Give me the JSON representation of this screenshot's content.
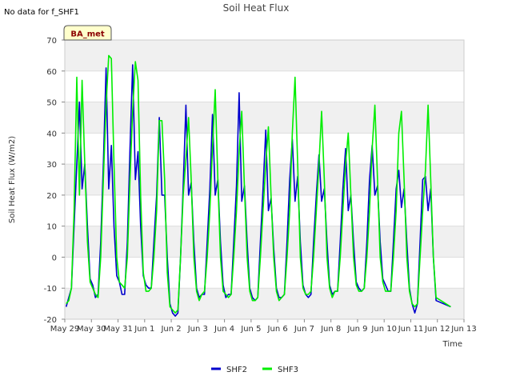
{
  "chart_data": {
    "type": "line",
    "title": "Soil Heat Flux",
    "note": "No data for f_SHF1",
    "badge": "BA_met",
    "xlabel": "Time",
    "ylabel": "Soil Heat Flux (W/m2)",
    "ylim": [
      -20,
      70
    ],
    "yticks": [
      -20,
      -10,
      0,
      10,
      20,
      30,
      40,
      50,
      60,
      70
    ],
    "xlim": [
      "2000-05-29",
      "2000-06-13"
    ],
    "xticks": [
      "May 29",
      "May 30",
      "May 31",
      "Jun 1",
      "Jun 2",
      "Jun 3",
      "Jun 4",
      "Jun 5",
      "Jun 6",
      "Jun 7",
      "Jun 8",
      "Jun 9",
      "Jun 10",
      "Jun 11",
      "Jun 12",
      "Jun 13"
    ],
    "grid": "horizontal bands",
    "legend": "bottom",
    "series": [
      {
        "name": "SHF2",
        "color": "#0000cc",
        "points": [
          [
            "May 29",
            -16
          ],
          [
            "May 29",
            -13
          ],
          [
            "May 29",
            -10
          ],
          [
            "May 29",
            10
          ],
          [
            "May 29",
            30
          ],
          [
            "May 29",
            50
          ],
          [
            "May 29",
            22
          ],
          [
            "May 29",
            30
          ],
          [
            "May 29",
            10
          ],
          [
            "May 29",
            -7
          ],
          [
            "May 30",
            -9
          ],
          [
            "May 30",
            -13
          ],
          [
            "May 30",
            -12
          ],
          [
            "May 30",
            5
          ],
          [
            "May 30",
            30
          ],
          [
            "May 30",
            61
          ],
          [
            "May 30",
            22
          ],
          [
            "May 30",
            36
          ],
          [
            "May 30",
            10
          ],
          [
            "May 30",
            -6
          ],
          [
            "May 31",
            -8
          ],
          [
            "May 31",
            -12
          ],
          [
            "May 31",
            -12
          ],
          [
            "May 31",
            5
          ],
          [
            "May 31",
            35
          ],
          [
            "May 31",
            62
          ],
          [
            "May 31",
            25
          ],
          [
            "May 31",
            34
          ],
          [
            "May 31",
            10
          ],
          [
            "May 31",
            -6
          ],
          [
            "Jun 1",
            -9
          ],
          [
            "Jun 1",
            -10
          ],
          [
            "Jun 1",
            -10
          ],
          [
            "Jun 1",
            5
          ],
          [
            "Jun 1",
            20
          ],
          [
            "Jun 1",
            45
          ],
          [
            "Jun 1",
            20
          ],
          [
            "Jun 1",
            20
          ],
          [
            "Jun 1",
            0
          ],
          [
            "Jun 1",
            -15
          ],
          [
            "Jun 2",
            -18
          ],
          [
            "Jun 2",
            -19
          ],
          [
            "Jun 2",
            -18
          ],
          [
            "Jun 2",
            0
          ],
          [
            "Jun 2",
            23
          ],
          [
            "Jun 2",
            49
          ],
          [
            "Jun 2",
            20
          ],
          [
            "Jun 2",
            24
          ],
          [
            "Jun 2",
            5
          ],
          [
            "Jun 2",
            -10
          ],
          [
            "Jun 3",
            -13
          ],
          [
            "Jun 3",
            -12
          ],
          [
            "Jun 3",
            -12
          ],
          [
            "Jun 3",
            5
          ],
          [
            "Jun 3",
            22
          ],
          [
            "Jun 3",
            46
          ],
          [
            "Jun 3",
            20
          ],
          [
            "Jun 3",
            25
          ],
          [
            "Jun 3",
            5
          ],
          [
            "Jun 3",
            -9
          ],
          [
            "Jun 4",
            -13
          ],
          [
            "Jun 4",
            -12
          ],
          [
            "Jun 4",
            -12
          ],
          [
            "Jun 4",
            5
          ],
          [
            "Jun 4",
            23
          ],
          [
            "Jun 4",
            53
          ],
          [
            "Jun 4",
            18
          ],
          [
            "Jun 4",
            23
          ],
          [
            "Jun 4",
            5
          ],
          [
            "Jun 4",
            -10
          ],
          [
            "Jun 5",
            -13
          ],
          [
            "Jun 5",
            -14
          ],
          [
            "Jun 5",
            -13
          ],
          [
            "Jun 5",
            5
          ],
          [
            "Jun 5",
            22
          ],
          [
            "Jun 5",
            41
          ],
          [
            "Jun 5",
            15
          ],
          [
            "Jun 5",
            19
          ],
          [
            "Jun 5",
            3
          ],
          [
            "Jun 5",
            -10
          ],
          [
            "Jun 6",
            -13
          ],
          [
            "Jun 6",
            -13
          ],
          [
            "Jun 6",
            -12
          ],
          [
            "Jun 6",
            5
          ],
          [
            "Jun 6",
            25
          ],
          [
            "Jun 6",
            38
          ],
          [
            "Jun 6",
            18
          ],
          [
            "Jun 6",
            26
          ],
          [
            "Jun 6",
            5
          ],
          [
            "Jun 6",
            -9
          ],
          [
            "Jun 7",
            -12
          ],
          [
            "Jun 7",
            -13
          ],
          [
            "Jun 7",
            -12
          ],
          [
            "Jun 7",
            5
          ],
          [
            "Jun 7",
            20
          ],
          [
            "Jun 7",
            33
          ],
          [
            "Jun 7",
            18
          ],
          [
            "Jun 7",
            22
          ],
          [
            "Jun 7",
            5
          ],
          [
            "Jun 7",
            -9
          ],
          [
            "Jun 8",
            -12
          ],
          [
            "Jun 8",
            -11
          ],
          [
            "Jun 8",
            -11
          ],
          [
            "Jun 8",
            5
          ],
          [
            "Jun 8",
            22
          ],
          [
            "Jun 8",
            35
          ],
          [
            "Jun 8",
            15
          ],
          [
            "Jun 8",
            20
          ],
          [
            "Jun 8",
            5
          ],
          [
            "Jun 8",
            -8
          ],
          [
            "Jun 9",
            -10
          ],
          [
            "Jun 9",
            -11
          ],
          [
            "Jun 9",
            -10
          ],
          [
            "Jun 9",
            5
          ],
          [
            "Jun 9",
            25
          ],
          [
            "Jun 9",
            36
          ],
          [
            "Jun 9",
            20
          ],
          [
            "Jun 9",
            23
          ],
          [
            "Jun 9",
            5
          ],
          [
            "Jun 9",
            -7
          ],
          [
            "Jun 10",
            -9
          ],
          [
            "Jun 10",
            -11
          ],
          [
            "Jun 10",
            -11
          ],
          [
            "Jun 10",
            5
          ],
          [
            "Jun 10",
            22
          ],
          [
            "Jun 10",
            28
          ],
          [
            "Jun 10",
            16
          ],
          [
            "Jun 10",
            22
          ],
          [
            "Jun 10",
            5
          ],
          [
            "Jun 10",
            -10
          ],
          [
            "Jun 11",
            -15
          ],
          [
            "Jun 11",
            -18
          ],
          [
            "Jun 11",
            -15
          ],
          [
            "Jun 11",
            5
          ],
          [
            "Jun 11",
            25
          ],
          [
            "Jun 11",
            26
          ],
          [
            "Jun 11",
            15
          ],
          [
            "Jun 11",
            22
          ],
          [
            "Jun 11",
            0
          ],
          [
            "Jun 11",
            -14
          ],
          [
            "Jun 12",
            -16
          ]
        ]
      },
      {
        "name": "SHF3",
        "color": "#00ee00",
        "points": [
          [
            "May 29",
            -15
          ],
          [
            "May 29",
            -14
          ],
          [
            "May 29",
            -10
          ],
          [
            "May 29",
            15
          ],
          [
            "May 29",
            58
          ],
          [
            "May 29",
            20
          ],
          [
            "May 29",
            57
          ],
          [
            "May 29",
            30
          ],
          [
            "May 29",
            5
          ],
          [
            "May 29",
            -8
          ],
          [
            "May 30",
            -10
          ],
          [
            "May 30",
            -12
          ],
          [
            "May 30",
            -13
          ],
          [
            "May 30",
            0
          ],
          [
            "May 30",
            25
          ],
          [
            "May 30",
            49
          ],
          [
            "May 30",
            65
          ],
          [
            "May 30",
            64
          ],
          [
            "May 30",
            30
          ],
          [
            "May 30",
            0
          ],
          [
            "May 31",
            -8
          ],
          [
            "May 31",
            -9
          ],
          [
            "May 31",
            -10
          ],
          [
            "May 31",
            0
          ],
          [
            "May 31",
            25
          ],
          [
            "May 31",
            47
          ],
          [
            "May 31",
            63
          ],
          [
            "May 31",
            57
          ],
          [
            "May 31",
            20
          ],
          [
            "May 31",
            -5
          ],
          [
            "Jun 1",
            -11
          ],
          [
            "Jun 1",
            -11
          ],
          [
            "Jun 1",
            -10
          ],
          [
            "Jun 1",
            0
          ],
          [
            "Jun 1",
            15
          ],
          [
            "Jun 1",
            44
          ],
          [
            "Jun 1",
            44
          ],
          [
            "Jun 1",
            25
          ],
          [
            "Jun 1",
            -5
          ],
          [
            "Jun 1",
            -16
          ],
          [
            "Jun 2",
            -17
          ],
          [
            "Jun 2",
            -18
          ],
          [
            "Jun 2",
            -17
          ],
          [
            "Jun 2",
            0
          ],
          [
            "Jun 2",
            20
          ],
          [
            "Jun 2",
            32
          ],
          [
            "Jun 2",
            45
          ],
          [
            "Jun 2",
            25
          ],
          [
            "Jun 2",
            0
          ],
          [
            "Jun 2",
            -11
          ],
          [
            "Jun 3",
            -14
          ],
          [
            "Jun 3",
            -12
          ],
          [
            "Jun 3",
            -11
          ],
          [
            "Jun 3",
            0
          ],
          [
            "Jun 3",
            15
          ],
          [
            "Jun 3",
            35
          ],
          [
            "Jun 3",
            54
          ],
          [
            "Jun 3",
            25
          ],
          [
            "Jun 3",
            0
          ],
          [
            "Jun 3",
            -11
          ],
          [
            "Jun 4",
            -12
          ],
          [
            "Jun 4",
            -13
          ],
          [
            "Jun 4",
            -12
          ],
          [
            "Jun 4",
            0
          ],
          [
            "Jun 4",
            15
          ],
          [
            "Jun 4",
            34
          ],
          [
            "Jun 4",
            47
          ],
          [
            "Jun 4",
            22
          ],
          [
            "Jun 4",
            0
          ],
          [
            "Jun 4",
            -11
          ],
          [
            "Jun 5",
            -14
          ],
          [
            "Jun 5",
            -14
          ],
          [
            "Jun 5",
            -13
          ],
          [
            "Jun 5",
            0
          ],
          [
            "Jun 5",
            15
          ],
          [
            "Jun 5",
            30
          ],
          [
            "Jun 5",
            42
          ],
          [
            "Jun 5",
            20
          ],
          [
            "Jun 5",
            0
          ],
          [
            "Jun 5",
            -11
          ],
          [
            "Jun 6",
            -14
          ],
          [
            "Jun 6",
            -13
          ],
          [
            "Jun 6",
            -12
          ],
          [
            "Jun 6",
            0
          ],
          [
            "Jun 6",
            15
          ],
          [
            "Jun 6",
            40
          ],
          [
            "Jun 6",
            58
          ],
          [
            "Jun 6",
            30
          ],
          [
            "Jun 6",
            0
          ],
          [
            "Jun 6",
            -10
          ],
          [
            "Jun 7",
            -12
          ],
          [
            "Jun 7",
            -12
          ],
          [
            "Jun 7",
            -11
          ],
          [
            "Jun 7",
            0
          ],
          [
            "Jun 7",
            15
          ],
          [
            "Jun 7",
            30
          ],
          [
            "Jun 7",
            47
          ],
          [
            "Jun 7",
            25
          ],
          [
            "Jun 7",
            0
          ],
          [
            "Jun 7",
            -10
          ],
          [
            "Jun 8",
            -13
          ],
          [
            "Jun 8",
            -11
          ],
          [
            "Jun 8",
            -11
          ],
          [
            "Jun 8",
            0
          ],
          [
            "Jun 8",
            15
          ],
          [
            "Jun 8",
            30
          ],
          [
            "Jun 8",
            40
          ],
          [
            "Jun 8",
            20
          ],
          [
            "Jun 8",
            0
          ],
          [
            "Jun 8",
            -9
          ],
          [
            "Jun 9",
            -11
          ],
          [
            "Jun 9",
            -11
          ],
          [
            "Jun 9",
            -10
          ],
          [
            "Jun 9",
            0
          ],
          [
            "Jun 9",
            15
          ],
          [
            "Jun 9",
            35
          ],
          [
            "Jun 9",
            49
          ],
          [
            "Jun 9",
            25
          ],
          [
            "Jun 9",
            0
          ],
          [
            "Jun 9",
            -8
          ],
          [
            "Jun 10",
            -11
          ],
          [
            "Jun 10",
            -11
          ],
          [
            "Jun 10",
            -11
          ],
          [
            "Jun 10",
            0
          ],
          [
            "Jun 10",
            15
          ],
          [
            "Jun 10",
            40
          ],
          [
            "Jun 10",
            47
          ],
          [
            "Jun 10",
            25
          ],
          [
            "Jun 10",
            0
          ],
          [
            "Jun 10",
            -11
          ],
          [
            "Jun 11",
            -15
          ],
          [
            "Jun 11",
            -16
          ],
          [
            "Jun 11",
            -15
          ],
          [
            "Jun 11",
            0
          ],
          [
            "Jun 11",
            15
          ],
          [
            "Jun 11",
            28
          ],
          [
            "Jun 11",
            49
          ],
          [
            "Jun 11",
            25
          ],
          [
            "Jun 11",
            0
          ],
          [
            "Jun 11",
            -13
          ],
          [
            "Jun 12",
            -16
          ]
        ]
      }
    ]
  }
}
